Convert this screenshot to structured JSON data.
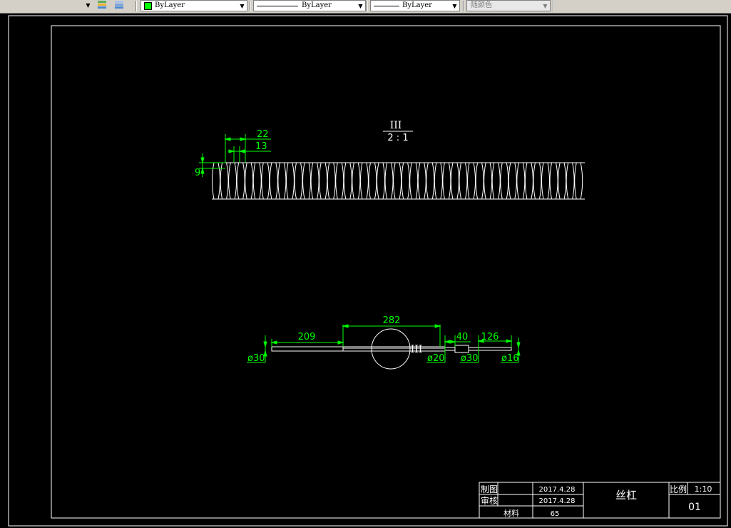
{
  "toolbar": {
    "color": {
      "label": "ByLayer",
      "swatch": "#00ff00"
    },
    "linetype": {
      "label": "ByLayer"
    },
    "lineweight": {
      "label": "ByLayer"
    },
    "plotstyle": {
      "label": "随颜色"
    }
  },
  "drawing": {
    "detail_label": "III",
    "detail_scale": "2 : 1",
    "detail_dims": {
      "pitch": "22",
      "thread_width": "13",
      "thread_depth": "9"
    },
    "shaft_dims": {
      "left_length": "209",
      "mid_length": "282",
      "step_length": "40",
      "end_length": "126",
      "dia_left": "ø30",
      "dia_mid": "ø20",
      "dia_step": "ø30",
      "dia_end": "ø16"
    },
    "detail_callout": "III"
  },
  "title_block": {
    "drawn_label": "制图",
    "checked_label": "审核",
    "drawn_date": "2017.4.28",
    "checked_date": "2017.4.28",
    "material_label": "材料",
    "material_value": "65",
    "part_name": "丝杠",
    "scale_label": "比例",
    "scale_value": "1:10",
    "drawing_number": "01"
  }
}
